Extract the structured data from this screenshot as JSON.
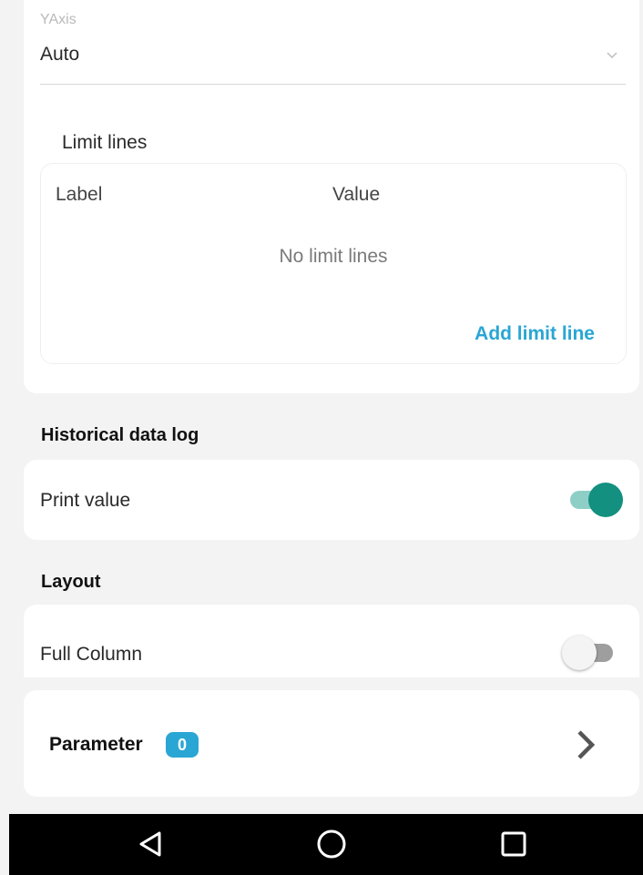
{
  "yaxis": {
    "label": "YAxis",
    "value": "Auto"
  },
  "limit_lines": {
    "title": "Limit lines",
    "columns": [
      "Label",
      "Value"
    ],
    "empty_text": "No limit lines",
    "add_button": "Add limit line"
  },
  "historical": {
    "section_title": "Historical data log",
    "print_value_label": "Print value",
    "print_value_on": true
  },
  "layout": {
    "section_title": "Layout",
    "full_column_label": "Full Column",
    "full_column_on": false
  },
  "parameter": {
    "label": "Parameter",
    "count": "0"
  },
  "colors": {
    "accent_teal": "#13907f",
    "accent_blue": "#2aa6d4"
  },
  "icons": {
    "select_chevron": "chevron-down-icon",
    "parameter_chevron": "chevron-right-icon",
    "nav_back": "back-triangle-icon",
    "nav_home": "home-circle-icon",
    "nav_recents": "recents-square-icon"
  }
}
